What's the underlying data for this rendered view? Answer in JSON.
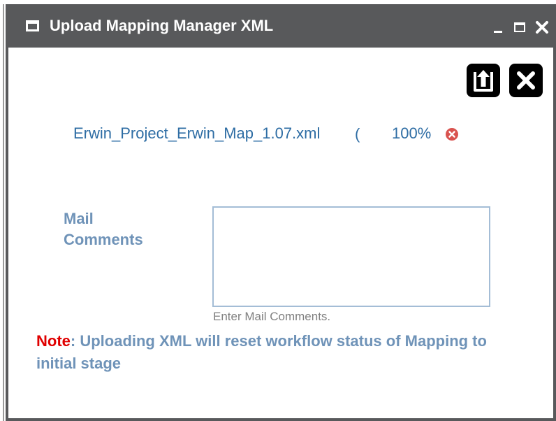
{
  "window": {
    "title": "Upload Mapping Manager XML",
    "controls": [
      "minimize",
      "maximize",
      "close"
    ]
  },
  "actions": {
    "upload_icon": "upload-icon",
    "close_icon": "close-icon"
  },
  "file": {
    "name": "Erwin_Project_Erwin_Map_1.07.xml",
    "name_suffix": "(",
    "progress": "100%",
    "remove_icon": "remove-circle-icon"
  },
  "mail": {
    "label": "Mail Comments",
    "value": "",
    "hint": "Enter Mail Comments."
  },
  "note": {
    "label": "Note",
    "text": ": Uploading XML will reset workflow status of Mapping to initial stage"
  },
  "colors": {
    "titlebar": "#58595b",
    "link_blue": "#2e6da4",
    "label_blue": "#6f93b8",
    "note_red": "#e00000",
    "remove_red": "#d9534f"
  }
}
